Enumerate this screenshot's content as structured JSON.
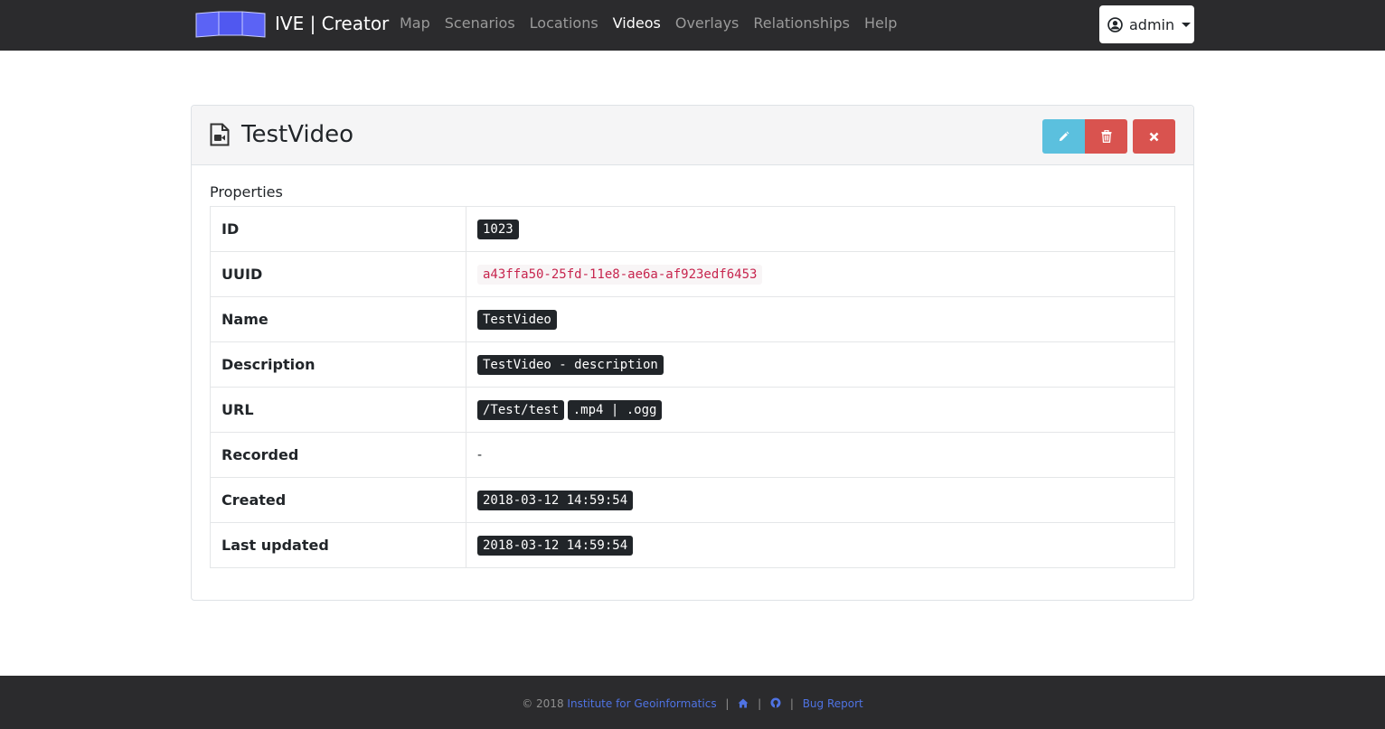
{
  "navbar": {
    "brand": "IVE | Creator",
    "items": [
      {
        "label": "Map",
        "active": false
      },
      {
        "label": "Scenarios",
        "active": false
      },
      {
        "label": "Locations",
        "active": false
      },
      {
        "label": "Videos",
        "active": true
      },
      {
        "label": "Overlays",
        "active": false
      },
      {
        "label": "Relationships",
        "active": false
      },
      {
        "label": "Help",
        "active": false
      }
    ],
    "user": {
      "label": "admin"
    }
  },
  "card": {
    "title": "TestVideo",
    "section_label": "Properties",
    "rows": {
      "id": {
        "label": "ID",
        "value": "1023"
      },
      "uuid": {
        "label": "UUID",
        "value": "a43ffa50-25fd-11e8-ae6a-af923edf6453"
      },
      "name": {
        "label": "Name",
        "value": "TestVideo"
      },
      "description": {
        "label": "Description",
        "value": "TestVideo - description"
      },
      "url": {
        "label": "URL",
        "value": "/Test/test",
        "extensions": ".mp4 | .ogg"
      },
      "recorded": {
        "label": "Recorded",
        "value": "-"
      },
      "created": {
        "label": "Created",
        "value": "2018-03-12 14:59:54"
      },
      "updated": {
        "label": "Last updated",
        "value": "2018-03-12 14:59:54"
      }
    }
  },
  "footer": {
    "copyright": "© 2018",
    "institute": "Institute for Geoinformatics",
    "separator": "|",
    "bug_report": "Bug Report"
  },
  "colors": {
    "navbar_bg": "#2b2b2d",
    "info": "#5bc0de",
    "danger": "#d9534f",
    "link": "#4f73e3"
  }
}
